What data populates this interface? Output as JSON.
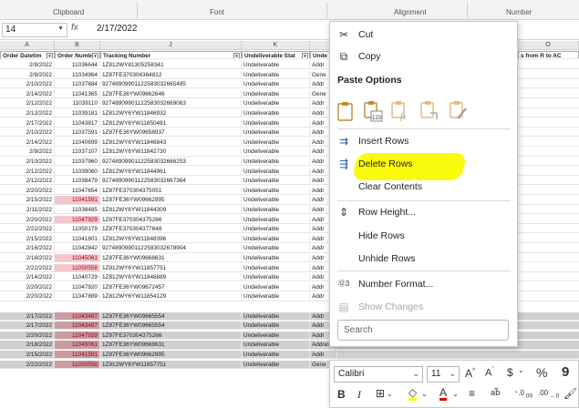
{
  "ribbon": {
    "groups": [
      "Clipboard",
      "Font",
      "Alignment",
      "Number"
    ]
  },
  "formula_bar": {
    "name_box": "14",
    "fx": "fx",
    "value": "2/17/2022"
  },
  "columns": {
    "letters": [
      "A",
      "B",
      "J",
      "K",
      "L",
      "O"
    ],
    "headers": [
      "Order Datetim",
      "Order Number",
      "Tracking Number",
      "Undeliverable Stat",
      "Unde",
      "s from R to AC"
    ]
  },
  "rows": [
    {
      "date": "2/9/2022",
      "order": "11036644",
      "tracking": "1Z812WY81305258341",
      "status": "Undeliverable",
      "l": "Addr",
      "pink": false
    },
    {
      "date": "2/9/2022",
      "order": "11034964",
      "tracking": "1Z87FE370304364812",
      "status": "Undeliverable",
      "l": "Gene",
      "pink": false
    },
    {
      "date": "2/10/2022",
      "order": "11037684",
      "tracking": "92748909901122583032665485",
      "status": "Undeliverable",
      "l": "Addr",
      "pink": false
    },
    {
      "date": "2/14/2022",
      "order": "11041365",
      "tracking": "1Z87FE36YW09662646",
      "status": "Undeliverable",
      "l": "Gene",
      "pink": false
    },
    {
      "date": "2/12/2022",
      "order": "11039110",
      "tracking": "92748909901122583032669063",
      "status": "Undeliverable",
      "l": "Addr",
      "pink": false
    },
    {
      "date": "2/12/2022",
      "order": "11039181",
      "tracking": "1Z812WY6YW11846932",
      "status": "Undeliverable",
      "l": "Addr",
      "pink": false
    },
    {
      "date": "2/17/2022",
      "order": "11043817",
      "tracking": "1Z812WY6YW11850481",
      "status": "Undeliverable",
      "l": "Addr",
      "pink": false
    },
    {
      "date": "2/10/2022",
      "order": "11037591",
      "tracking": "1Z87FE36YW09658937",
      "status": "Undeliverable",
      "l": "Addr",
      "pink": false
    },
    {
      "date": "2/14/2022",
      "order": "11040699",
      "tracking": "1Z812WY6YW11846843",
      "status": "Undeliverable",
      "l": "Addr",
      "pink": false
    },
    {
      "date": "2/9/2022",
      "order": "11037107",
      "tracking": "1Z812WY6YW11842730",
      "status": "Undeliverable",
      "l": "Addr",
      "pink": false
    },
    {
      "date": "2/10/2022",
      "order": "11037960",
      "tracking": "92748909901122583032666253",
      "status": "Undeliverable",
      "l": "Addr",
      "pink": false
    },
    {
      "date": "2/12/2022",
      "order": "11039060",
      "tracking": "1Z812WY6YW11844961",
      "status": "Undeliverable",
      "l": "Addr",
      "pink": false
    },
    {
      "date": "2/12/2022",
      "order": "11038479",
      "tracking": "92748909901122583032667364",
      "status": "Undeliverable",
      "l": "Addr",
      "pink": false
    },
    {
      "date": "2/20/2022",
      "order": "11047654",
      "tracking": "1Z87FE370304375051",
      "status": "Undeliverable",
      "l": "Addr",
      "pink": false
    },
    {
      "date": "2/15/2022",
      "order": "11041591",
      "tracking": "1Z87FE36YW09662995",
      "status": "Undeliverable",
      "l": "Addr",
      "pink": true
    },
    {
      "date": "2/11/2022",
      "order": "11038485",
      "tracking": "1Z812WY6YW11844309",
      "status": "Undeliverable",
      "l": "Addr",
      "pink": false
    },
    {
      "date": "2/20/2022",
      "order": "11047929",
      "tracking": "1Z87FE370304375266",
      "status": "Undeliverable",
      "l": "Addr",
      "pink": true
    },
    {
      "date": "2/22/2022",
      "order": "11050179",
      "tracking": "1Z87FE370304377648",
      "status": "Undeliverable",
      "l": "Addr",
      "pink": false
    },
    {
      "date": "2/15/2022",
      "order": "11041601",
      "tracking": "1Z812WY6YW11848396",
      "status": "Undeliverable",
      "l": "Addr",
      "pink": false
    },
    {
      "date": "2/16/2022",
      "order": "11042842",
      "tracking": "92748909901122583032678904",
      "status": "Undeliverable",
      "l": "Addr",
      "pink": false
    },
    {
      "date": "2/18/2022",
      "order": "11045061",
      "tracking": "1Z87FE36YW09668631",
      "status": "Undeliverable",
      "l": "Addr",
      "pink": true
    },
    {
      "date": "2/22/2022",
      "order": "11050558",
      "tracking": "1Z812WY6YW11857751",
      "status": "Undeliverable",
      "l": "Addr",
      "pink": true
    },
    {
      "date": "2/14/2022",
      "order": "11040729",
      "tracking": "1Z812WY6YW11846889",
      "status": "Undeliverable",
      "l": "Addr",
      "pink": false
    },
    {
      "date": "2/20/2022",
      "order": "11047920",
      "tracking": "1Z87FE36YW09672457",
      "status": "Undeliverable",
      "l": "Addr",
      "pink": false
    },
    {
      "date": "2/20/2022",
      "order": "11047889",
      "tracking": "1Z812WY6YW11854129",
      "status": "Undeliverable",
      "l": "Addr",
      "pink": false
    }
  ],
  "selected_rows": [
    {
      "date": "2/17/2022",
      "order": "11043497",
      "tracking": "1Z87FE36YW09665554",
      "status": "Undeliverable",
      "l": "Addr"
    },
    {
      "date": "2/17/2022",
      "order": "11043497",
      "tracking": "1Z87FE36YW09665554",
      "status": "Undeliverable",
      "l": "Addr"
    },
    {
      "date": "2/20/2022",
      "order": "11047929",
      "tracking": "1Z87FE370304375266",
      "status": "Undeliverable",
      "l": "Addr"
    },
    {
      "date": "2/18/2022",
      "order": "11045061",
      "tracking": "1Z87FE36YW09668631",
      "status": "Undeliverable",
      "l": "Address"
    },
    {
      "date": "2/15/2022",
      "order": "11041591",
      "tracking": "1Z87FE36YW09662995",
      "status": "Undeliverable",
      "l": "Addr"
    },
    {
      "date": "2/22/2022",
      "order": "11050558",
      "tracking": "1Z812WY6YW11857751",
      "status": "Undeliverable",
      "l": "Gene"
    }
  ],
  "context_menu": {
    "cut": "Cut",
    "copy": "Copy",
    "paste_options": "Paste Options",
    "insert_rows": "Insert Rows",
    "delete_rows": "Delete Rows",
    "clear_contents": "Clear Contents",
    "row_height": "Row Height...",
    "hide_rows": "Hide Rows",
    "unhide_rows": "Unhide Rows",
    "number_format": "Number Format...",
    "show_changes": "Show Changes",
    "search_placeholder": "Search"
  },
  "mini_toolbar": {
    "font_name": "Calibri",
    "font_size": "11",
    "bold": "B",
    "italic": "I",
    "currency": "$",
    "percent": "%",
    "comma": "9"
  },
  "colors": {
    "highlight": "#fafa00",
    "pink_fill": "#f4c7ce",
    "pink_text": "#9c0006",
    "selection": "#d0d0d0"
  }
}
